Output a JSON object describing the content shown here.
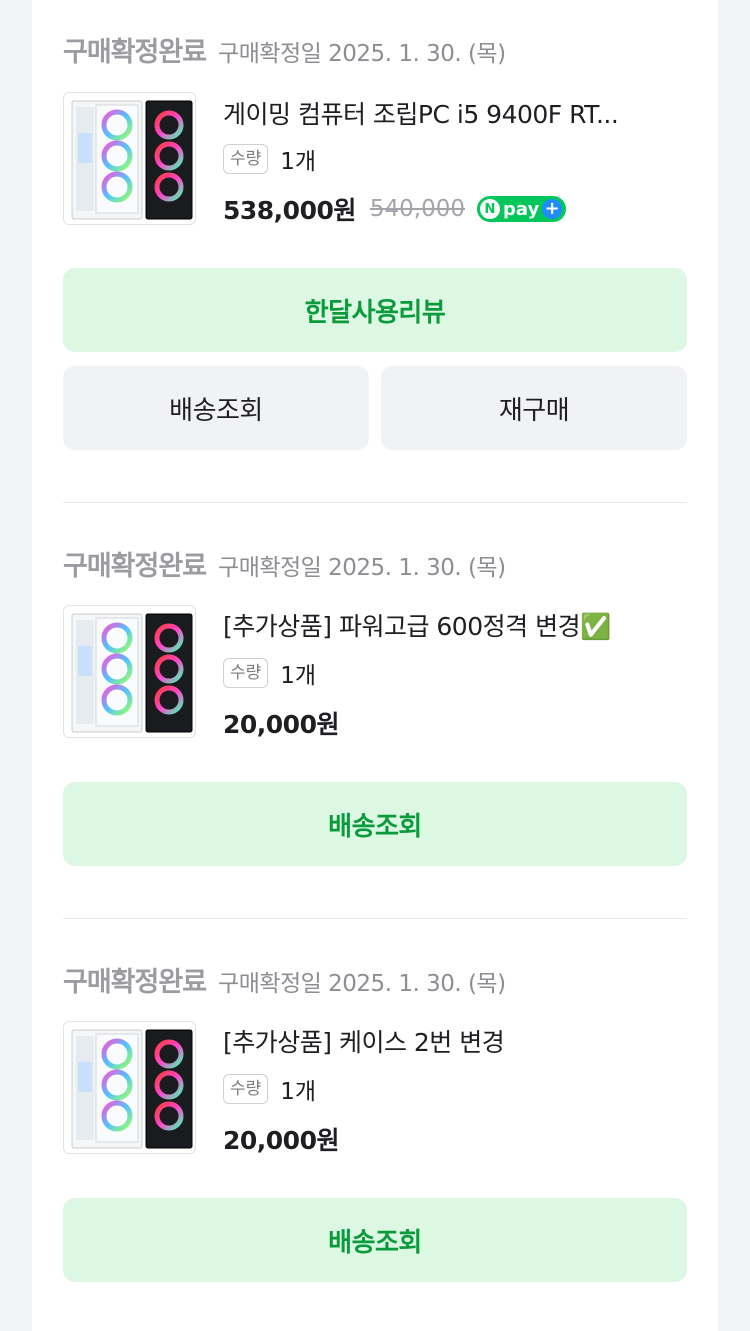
{
  "orders": [
    {
      "status": "구매확정완료",
      "confirm_date": "구매확정일 2025. 1. 30. (목)",
      "product_name": "게이밍 컴퓨터 조립PC i5 9400F RT...",
      "qty_label": "수량",
      "qty_value": "1개",
      "price": "538,000원",
      "original_price": "540,000",
      "npay_label": "pay",
      "buttons": {
        "review": "한달사용리뷰",
        "delivery": "배송조회",
        "rebuy": "재구매"
      }
    },
    {
      "status": "구매확정완료",
      "confirm_date": "구매확정일 2025. 1. 30. (목)",
      "product_name": "[추가상품] 파워고급 600정격 변경✅",
      "qty_label": "수량",
      "qty_value": "1개",
      "price": "20,000원",
      "buttons": {
        "delivery": "배송조회"
      }
    },
    {
      "status": "구매확정완료",
      "confirm_date": "구매확정일 2025. 1. 30. (목)",
      "product_name": "[추가상품] 케이스 2번 변경",
      "qty_label": "수량",
      "qty_value": "1개",
      "price": "20,000원",
      "buttons": {
        "delivery": "배송조회"
      }
    }
  ],
  "colors": {
    "accent_green": "#0b9a3c",
    "green_button_bg": "#dcf8e2",
    "npay_green": "#03c75a"
  },
  "icons": {
    "product_thumbnail": "pc-case-image",
    "npay_badge": "npay-plus-icon"
  }
}
